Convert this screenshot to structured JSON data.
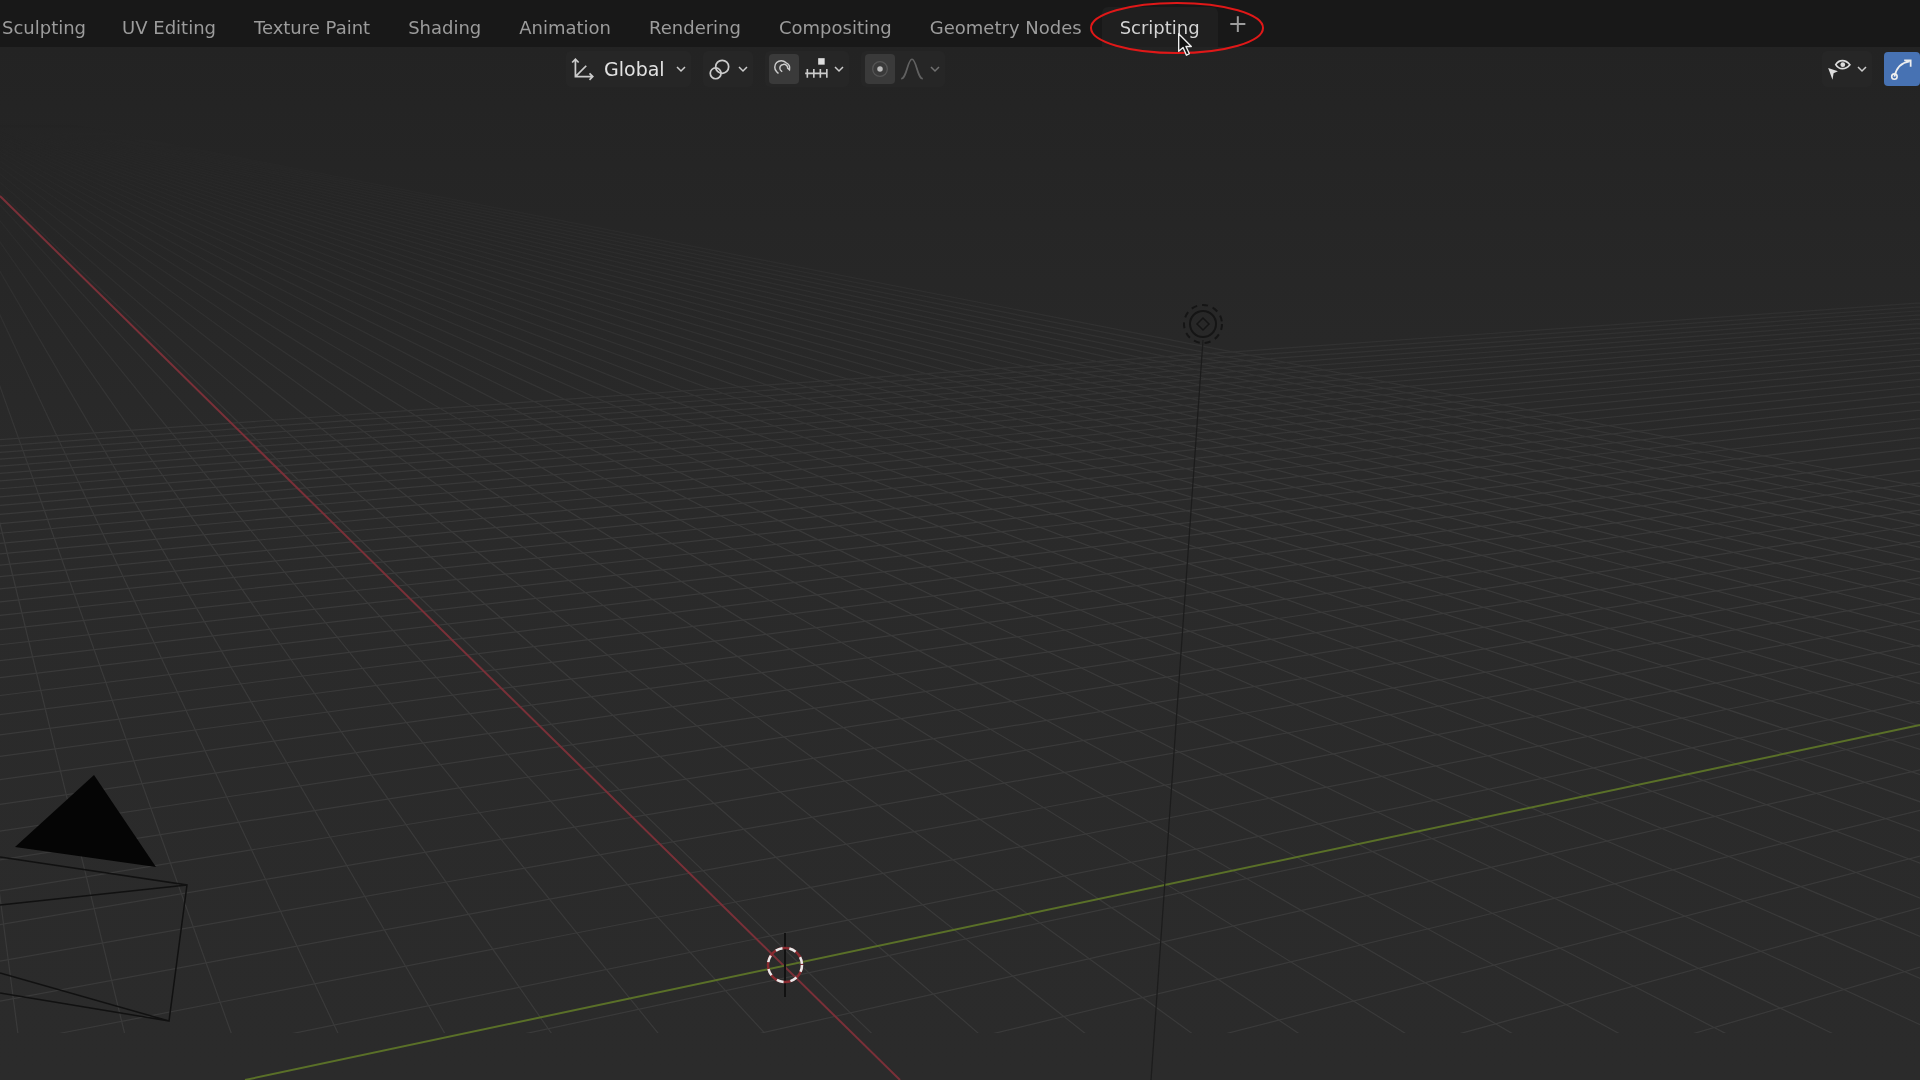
{
  "workspace_tabs": [
    {
      "label": "Sculpting",
      "selected": false
    },
    {
      "label": "UV Editing",
      "selected": false
    },
    {
      "label": "Texture Paint",
      "selected": false
    },
    {
      "label": "Shading",
      "selected": false
    },
    {
      "label": "Animation",
      "selected": false
    },
    {
      "label": "Rendering",
      "selected": false
    },
    {
      "label": "Compositing",
      "selected": false
    },
    {
      "label": "Geometry Nodes",
      "selected": false
    },
    {
      "label": "Scripting",
      "selected": true
    }
  ],
  "add_tab": "+",
  "header": {
    "orientation": "Global",
    "snap": {
      "on": false
    },
    "proportional_editing": {
      "on": false
    },
    "gizmo_toggle": {
      "on": true
    }
  }
}
